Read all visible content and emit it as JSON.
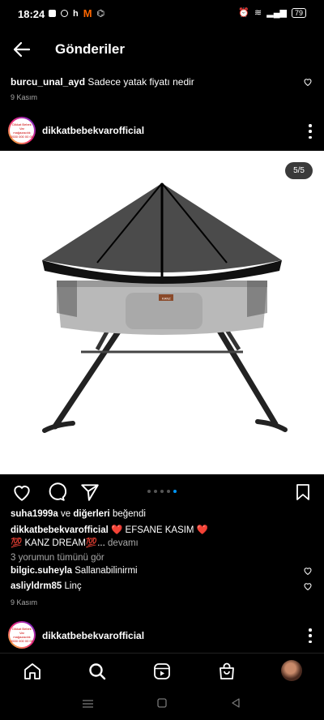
{
  "status": {
    "time": "18:24",
    "battery": "79",
    "left_icons": [
      "h",
      "M"
    ]
  },
  "nav": {
    "title": "Gönderiler"
  },
  "top_comment": {
    "user": "burcu_unal_ayd",
    "text": "Sadece yatak fiyatı nedir",
    "date": "9 Kasım"
  },
  "post": {
    "username": "dikkatbebekvarofficial",
    "counter": "5/5",
    "avatar_text": [
      "Dikkat Bebek Var",
      "mağazacılık",
      "0530 000 00 00"
    ],
    "likes_user": "suha1999a",
    "likes_mid": " ve ",
    "likes_others": "diğerleri",
    "likes_end": " beğendi",
    "caption_user": "dikkatbebekvarofficial",
    "caption_line1": " ❤️ EFSANE KASIM ❤️",
    "caption_line2": "💯 KANZ DREAM💯...",
    "caption_more": " devamı",
    "view_comments": "3 yorumun tümünü gör",
    "comments": [
      {
        "user": "bilgic.suheyla",
        "text": "Sallanabilinirmi"
      },
      {
        "user": "asliyldrm85",
        "text": "Linç"
      }
    ],
    "date": "9 Kasım",
    "product_label": "KANZ"
  },
  "next_post": {
    "username": "dikkatbebekvarofficial"
  },
  "bottom_nav": [
    "home-icon",
    "search-icon",
    "reels-icon",
    "shop-icon",
    "profile-avatar"
  ],
  "colors": {
    "accent": "#0095f6",
    "background": "#000000",
    "secondary_text": "#a8a8a8"
  }
}
